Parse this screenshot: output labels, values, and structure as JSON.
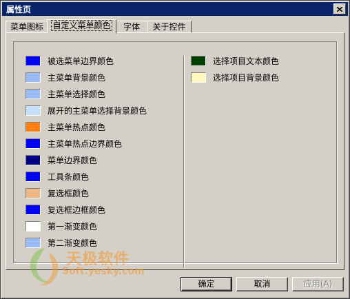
{
  "window": {
    "title": "属性页"
  },
  "tabs": [
    {
      "label": "菜单图标",
      "active": false
    },
    {
      "label": "自定义菜单颜色",
      "active": true
    },
    {
      "label": "字体",
      "active": false
    },
    {
      "label": "关于控件",
      "active": false
    }
  ],
  "left_colors": [
    {
      "label": "被选菜单边界颜色",
      "color": "#0000ff"
    },
    {
      "label": "主菜单背景颜色",
      "color": "#9ab9f5"
    },
    {
      "label": "主菜单选择颜色",
      "color": "#9ab9f5"
    },
    {
      "label": "展开的主菜单选择背景颜色",
      "color": "#c6e0fc"
    },
    {
      "label": "主菜单热点颜色",
      "color": "#ff7f10"
    },
    {
      "label": "主菜单热点边界颜色",
      "color": "#0000ff"
    },
    {
      "label": "菜单边界颜色",
      "color": "#000080"
    },
    {
      "label": "工具条颜色",
      "color": "#0000ff"
    },
    {
      "label": "复选框颜色",
      "color": "#f0b880"
    },
    {
      "label": "复选框边框颜色",
      "color": "#0000ff"
    },
    {
      "label": "第一渐变颜色",
      "color": "#ffffff"
    },
    {
      "label": "第二渐变颜色",
      "color": "#9ab9f5"
    }
  ],
  "right_colors": [
    {
      "label": "选择项目文本颜色",
      "color": "#004000"
    },
    {
      "label": "选择项目背景颜色",
      "color": "#fff8c0"
    }
  ],
  "buttons": {
    "ok": "确定",
    "cancel": "取消",
    "apply": "应用(A)"
  },
  "watermark": {
    "text": "天极软件",
    "sub": "Soft.yesky.com"
  }
}
